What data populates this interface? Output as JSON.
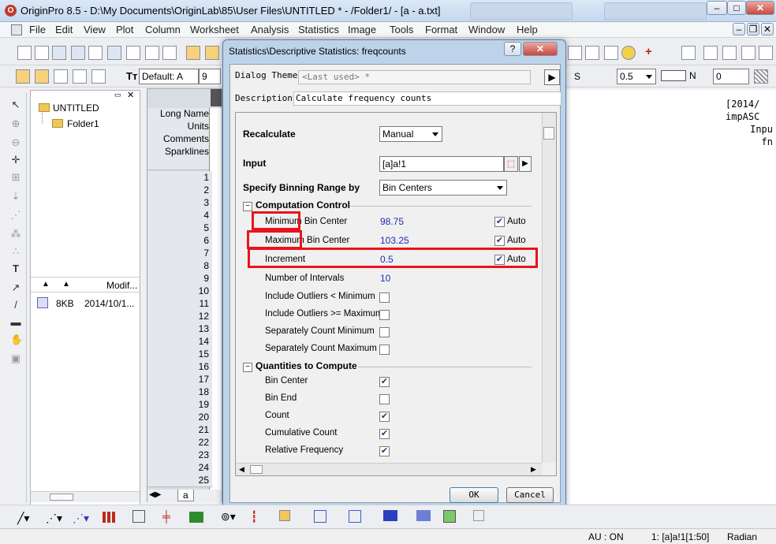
{
  "titlebar": {
    "title": "OriginPro 8.5 - D:\\My Documents\\OriginLab\\85\\User Files\\UNTITLED * - /Folder1/ - [a - a.txt]"
  },
  "menu": [
    "File",
    "Edit",
    "View",
    "Plot",
    "Column",
    "Worksheet",
    "Analysis",
    "Statistics",
    "Image",
    "Tools",
    "Format",
    "Window",
    "Help"
  ],
  "format_toolbar": {
    "font_name": "Default: A",
    "font_size": "9",
    "line_style": "S",
    "line_width": "0.5",
    "color": "N",
    "number": "0"
  },
  "project_explorer": {
    "root": "UNTITLED",
    "folder": "Folder1",
    "col_modified": "Modif...",
    "file_size": "8KB",
    "file_date": "2014/10/1..."
  },
  "worksheet": {
    "labels": [
      "Long Name",
      "Units",
      "Comments",
      "Sparklines"
    ],
    "rows": [
      "1",
      "2",
      "3",
      "4",
      "5",
      "6",
      "7",
      "8",
      "9",
      "10",
      "11",
      "12",
      "13",
      "14",
      "15",
      "16",
      "17",
      "18",
      "19",
      "20",
      "21",
      "22",
      "23",
      "24",
      "25"
    ],
    "sheet_tab": "a"
  },
  "right_panel": {
    "lines": [
      "[2014/",
      "impASC",
      "Inpu",
      "fn"
    ]
  },
  "dialog": {
    "title": "Statistics\\Descriptive Statistics: freqcounts",
    "help": "?",
    "dialog_theme_label": "Dialog Theme",
    "dialog_theme_value": "<Last used> *",
    "description_label": "Description",
    "description_value": "Calculate frequency counts",
    "recalculate_label": "Recalculate",
    "recalculate_value": "Manual",
    "input_label": "Input",
    "input_value": "[a]a!1",
    "binning_label": "Specify Binning Range by",
    "binning_value": "Bin Centers",
    "computation_control": "Computation Control",
    "min_label": "Minimum Bin Center",
    "min_value": "98.75",
    "max_label": "Maximum Bin Center",
    "max_value": "103.25",
    "increment_label": "Increment",
    "increment_value": "0.5",
    "auto_label": "Auto",
    "intervals_label": "Number of Intervals",
    "intervals_value": "10",
    "outliers_min_label": "Include Outliers < Minimum",
    "outliers_max_label": "Include Outliers >= Maximum",
    "sep_min_label": "Separately Count Minimum",
    "sep_max_label": "Separately Count Maximum",
    "quantities": "Quantities to Compute",
    "bin_center": "Bin Center",
    "bin_end": "Bin End",
    "count": "Count",
    "cumulative_count": "Cumulative Count",
    "relative_frequency": "Relative Frequency",
    "ok": "OK",
    "cancel": "Cancel"
  },
  "status": {
    "au": "AU : ON",
    "range": "1: [a]a!1[1:50]",
    "angle": "Radian"
  },
  "colors": {
    "highlight": "#e8141b",
    "value_text": "#1a2fb5",
    "dialog_frame": "#bcd3ea"
  }
}
